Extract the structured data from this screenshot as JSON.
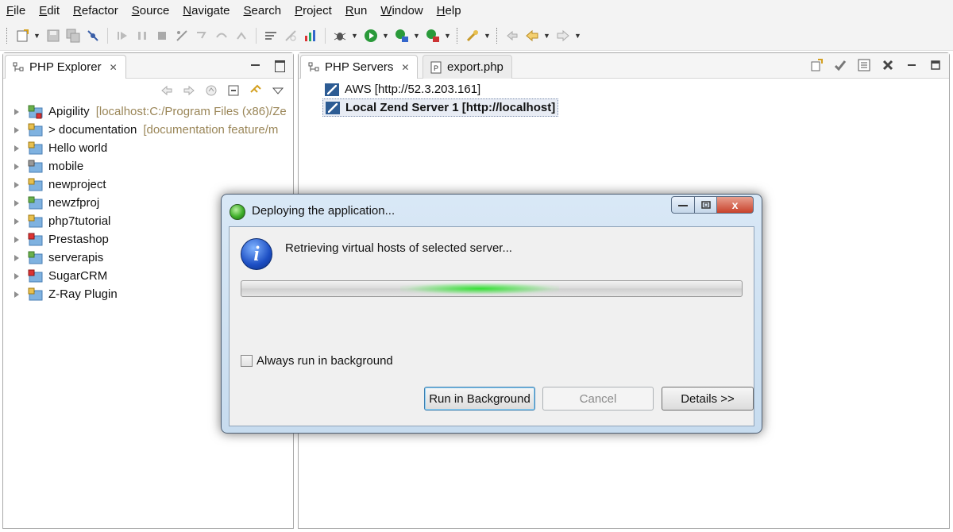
{
  "menubar": {
    "items": [
      "File",
      "Edit",
      "Refactor",
      "Source",
      "Navigate",
      "Search",
      "Project",
      "Run",
      "Window",
      "Help"
    ]
  },
  "toolbar": {
    "icons": [
      "new-icon",
      "save-icon",
      "save-all-icon",
      "toggle-breakpoint-icon",
      "resume-icon",
      "suspend-icon",
      "terminate-icon",
      "disconnect-icon",
      "step-into-icon",
      "step-over-icon",
      "step-return-icon",
      "use-step-filters-icon",
      "open-perspective-icon",
      "debug-icon",
      "run-icon",
      "run-server-icon",
      "stop-server-icon",
      "deploy-icon",
      "back-icon",
      "forward-icon"
    ]
  },
  "left_view": {
    "tab_label": "PHP Explorer",
    "tree": [
      {
        "label": "Apigility",
        "extra": "[localhost:C:/Program Files (x86)/Ze"
      },
      {
        "label": "> documentation",
        "extra": "[documentation feature/m"
      },
      {
        "label": "Hello world",
        "extra": ""
      },
      {
        "label": "mobile",
        "extra": ""
      },
      {
        "label": "newproject",
        "extra": ""
      },
      {
        "label": "newzfproj",
        "extra": ""
      },
      {
        "label": "php7tutorial",
        "extra": ""
      },
      {
        "label": "Prestashop",
        "extra": ""
      },
      {
        "label": "serverapis",
        "extra": ""
      },
      {
        "label": "SugarCRM",
        "extra": ""
      },
      {
        "label": "Z-Ray Plugin",
        "extra": ""
      }
    ]
  },
  "right_view": {
    "tabs": [
      {
        "label": "PHP Servers"
      },
      {
        "label": "export.php"
      }
    ],
    "servers": [
      {
        "label": "AWS [http://52.3.203.161]"
      },
      {
        "label": "Local Zend Server 1 [http://localhost]"
      }
    ]
  },
  "dialog": {
    "title": "Deploying the application...",
    "message": "Retrieving virtual hosts of selected server...",
    "progress_indeterminate": true,
    "checkbox_label": "Always run in background",
    "checkbox_checked": false,
    "buttons": {
      "run_in_background": "Run in Background",
      "cancel": "Cancel",
      "details": "Details >>"
    },
    "close_glyph": "x"
  },
  "colors": {
    "accent_blue": "#2d5c94",
    "dialog_frame": "#c7dcef",
    "progress_glow": "#34e034"
  }
}
